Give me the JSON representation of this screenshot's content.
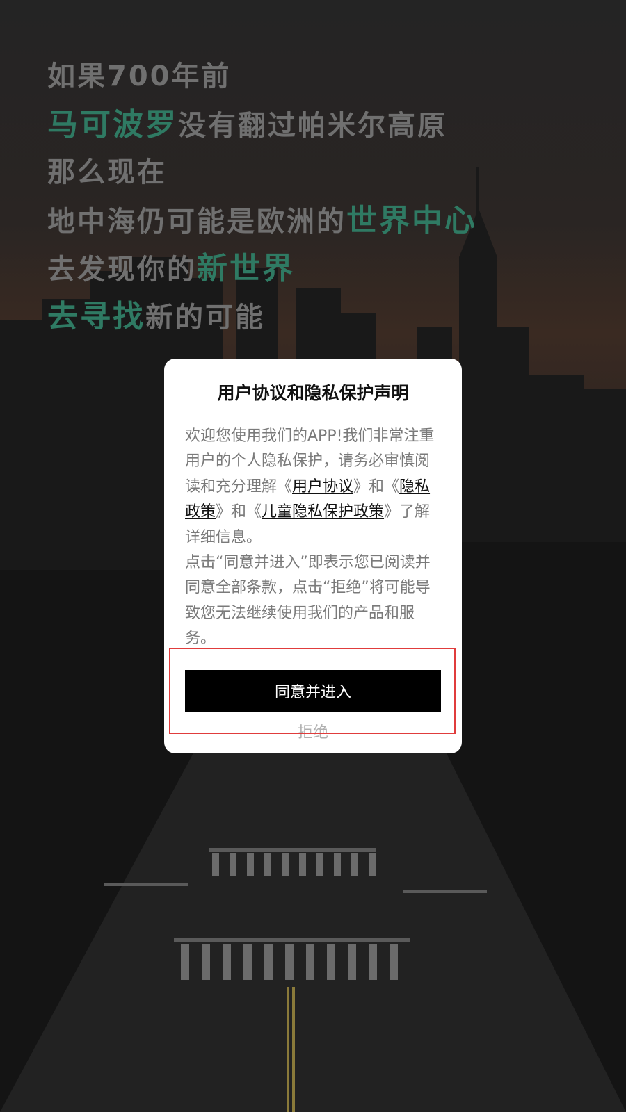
{
  "slogan": {
    "lines": [
      [
        {
          "text": "如果700年前",
          "hl": false
        }
      ],
      [
        {
          "text": "马可波罗",
          "hl": true
        },
        {
          "text": "没有翻过帕米尔高原",
          "hl": false
        }
      ],
      [
        {
          "text": "那么现在",
          "hl": false
        }
      ],
      [
        {
          "text": "地中海仍可能是欧洲的",
          "hl": false
        },
        {
          "text": "世界中心",
          "hl": true
        }
      ],
      [
        {
          "text": "去发现你的",
          "hl": false
        },
        {
          "text": "新世界",
          "hl": true
        }
      ],
      [
        {
          "text": "去寻找",
          "hl": true
        },
        {
          "text": "新的可能",
          "hl": false
        }
      ]
    ]
  },
  "dialog": {
    "title": "用户协议和隐私保护声明",
    "p1_a": "欢迎您使用我们的APP!我们非常注重用户的个人隐私保护，请务必审慎阅读和充分理解《",
    "link_user_agreement": "用户协议",
    "p1_b": "》和《",
    "link_privacy_policy": "隐私政策",
    "p1_c": "》和《",
    "link_child_privacy": "儿童隐私保护政策",
    "p1_d": "》了解详细信息。",
    "p2": "点击“同意并进入”即表示您已阅读并同意全部条款，点击“拒绝”将可能导致您无法继续使用我们的产品和服务。",
    "agree_label": "同意并进入",
    "refuse_label": "拒绝"
  },
  "colors": {
    "highlight": "#2f7a63",
    "annotation_box": "#e03c3c",
    "button_bg": "#000000"
  }
}
